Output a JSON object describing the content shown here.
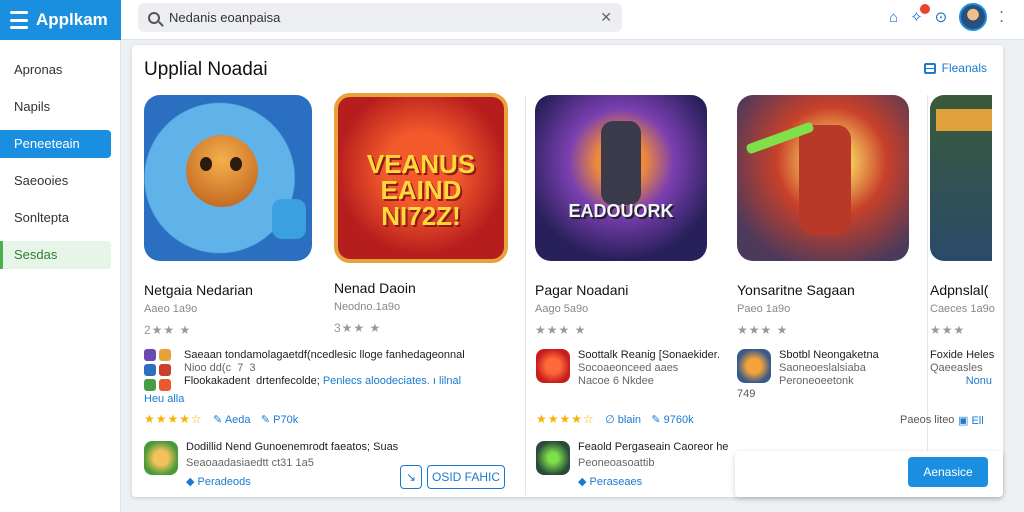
{
  "app": {
    "brand": "Applkam",
    "logo_icon": "list-icon"
  },
  "search": {
    "value": "Nedanis eoanpaisa",
    "placeholder": ""
  },
  "colors": {
    "accent": "#1a8fe0",
    "star": "#f5b400",
    "link": "#1a7ad0",
    "active_green": "#4caf50"
  },
  "sidebar": {
    "items": [
      {
        "label": "Apronas",
        "state": "normal"
      },
      {
        "label": "Napils",
        "state": "normal"
      },
      {
        "label": "Peneeteain",
        "state": "active"
      },
      {
        "label": "Saeooies",
        "state": "normal"
      },
      {
        "label": "Sonltepta",
        "state": "normal"
      },
      {
        "label": "Sesdas",
        "state": "green"
      }
    ]
  },
  "main": {
    "title": "Upplial Noadai",
    "action": "Fleanals",
    "apps": [
      {
        "name": "Netgaia Nedarian",
        "sub": "Aaeo 1a9o",
        "rating": "2★★ ★"
      },
      {
        "name": "Nenad Daoin",
        "sub": "Neodno.1a9o",
        "rating": "3★★ ★",
        "art_text": "VEANUS EAIND NI72Z!"
      },
      {
        "name": "Pagar Noadani",
        "sub": "Aago 5a9o",
        "rating": "★★★ ★",
        "art_text": "EADOUORK"
      },
      {
        "name": "Yonsaritne Sagaan",
        "sub": "Paeo 1a9o",
        "rating": "★★★ ★"
      },
      {
        "name": "Adpnslal(",
        "sub": "Caeces 1a9o",
        "rating": "★★★"
      }
    ],
    "col1": {
      "row1_line1": "Saeaan tondamolagaetdf(ncedlesic lloge fanhedageonnal",
      "row1_line2": "Nioo dd(c  7  3",
      "row1_line3": "Flookakadent  drtenfecolde;",
      "row1_link": "Penlecs aloodeciates. ı lilnal",
      "row1_line4": "Heu alla",
      "stars": "★★★★☆",
      "stars_meta1": "Aeda",
      "stars_meta2": "P70k",
      "row2_line1": "Dodillid Nend Gunoenemrodt faeatos; Suas",
      "row2_line2": "Seaoaadasiaedtt ct31 1a5",
      "row2_link": "Peradeods",
      "btn_small": "↘",
      "btn_outline": "OSID FAHIC"
    },
    "col2": {
      "row1_line1": "Soottalk Reanig [Sonaekider.",
      "row1_line2": "Socoaeonceed aaes",
      "row1_line3": "Nacoe 6 Nkdee",
      "stars": "★★★★☆",
      "stars_meta1": "blain",
      "stars_meta2": "9760k",
      "row2_line1": "Feaold Pergaseain Caoreor he",
      "row2_line2": "Peoneoasoattib",
      "row2_link": "Peraseaes"
    },
    "col3": {
      "row1_line1": "Sbotbl Neongaketna",
      "row1_line2": "Saoneoeslalsiaba",
      "row1_line3": "Peroneoeetonk",
      "row1_line4": "749",
      "footer1": "Paeos liteo",
      "footer2": "Ell"
    },
    "col4": {
      "row1_line1": "Foxide Heles",
      "row1_line2": "Qaeeasles",
      "row1_link": "Nonu"
    },
    "float_button": "Aenasice"
  }
}
